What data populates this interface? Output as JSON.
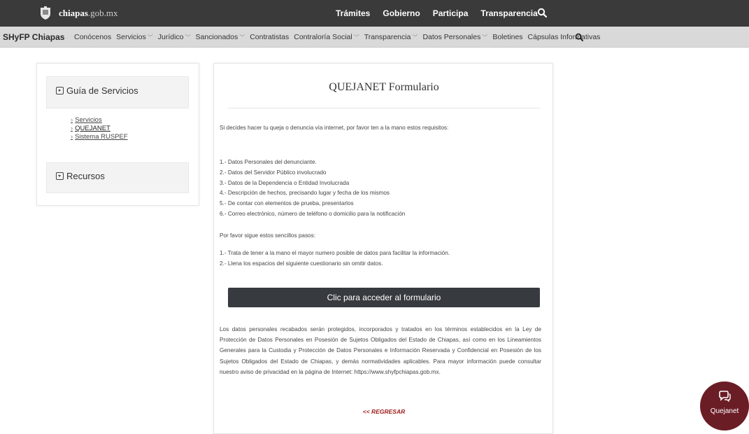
{
  "topbar": {
    "site_name_bold": "chiapas",
    "site_name_rest": ".gob.mx",
    "nav": [
      "Trámites",
      "Gobierno",
      "Participa",
      "Transparencia"
    ]
  },
  "secbar": {
    "brand": "SHyFP Chiapas",
    "items": [
      {
        "label": "Conócenos",
        "dropdown": false
      },
      {
        "label": "Servicios",
        "dropdown": true
      },
      {
        "label": "Jurídico",
        "dropdown": true
      },
      {
        "label": "Sancionados",
        "dropdown": true
      },
      {
        "label": "Contratistas",
        "dropdown": false
      },
      {
        "label": "Contraloría Social",
        "dropdown": true
      },
      {
        "label": "Transparencia",
        "dropdown": true
      },
      {
        "label": "Datos Personales",
        "dropdown": true
      },
      {
        "label": "Boletines",
        "dropdown": false
      },
      {
        "label": "Cápsulas Informativas",
        "dropdown": false
      }
    ]
  },
  "sidebar": {
    "section1": "Guía de Servicios",
    "links": [
      "Servicios",
      "QUEJANET",
      "Sistema RUSPEF"
    ],
    "section2": "Recursos"
  },
  "main": {
    "title": "QUEJANET Formulario",
    "intro": "Si decides hacer tu queja o denuncia vía internet, por favor ten a la mano estos requisitos:",
    "requirements": [
      "1.- Datos Personales del denunciante.",
      "2.- Datos del Servidor Público involucrado",
      "3.- Datos de la Dependencia o Entidad Involucrada",
      "4.- Descripción de hechos, precisando lugar y fecha de los mismos",
      "5.- De contar con elementos de prueba, presentarlos",
      "6.- Correo electrónico, número de teléfono o domicilio para la notificación"
    ],
    "steps_title": "Por favor sigue estos sencillos pasos:",
    "steps": [
      "1.- Trata de tener a la mano el mayor numero posible de datos para facilitar la información.",
      "2.- Llena los espacios del siguiente cuestionario sin omitir datos."
    ],
    "cta": "Clic para acceder al formulario",
    "privacy": "Los datos personales recabados serán protegidos, incorporados y tratados en los términos establecidos en la Ley de Protección de Datos Personales en Posesión  de Sujetos Obligados del Estado de Chiapas, así como en los Lineamientos Generales para la Custodia y Protección de Datos Personales e Información Reservada y Confidencial en Posesión de los Sujetos Obligados del Estado de Chiapas, y demás normatividades aplicables. Para mayor información puede consultar nuestro aviso de privacidad en la página de Internet: https://www.shyfpchiapas.gob.mx.",
    "back": "<< REGRESAR"
  },
  "fab": {
    "label": "Quejanet"
  },
  "colors": {
    "topbar": "#3a3a3a",
    "secbar": "#d9d9d9",
    "cta": "#373a3f",
    "back_link": "#a01c1c",
    "fab": "#6b1d26"
  }
}
